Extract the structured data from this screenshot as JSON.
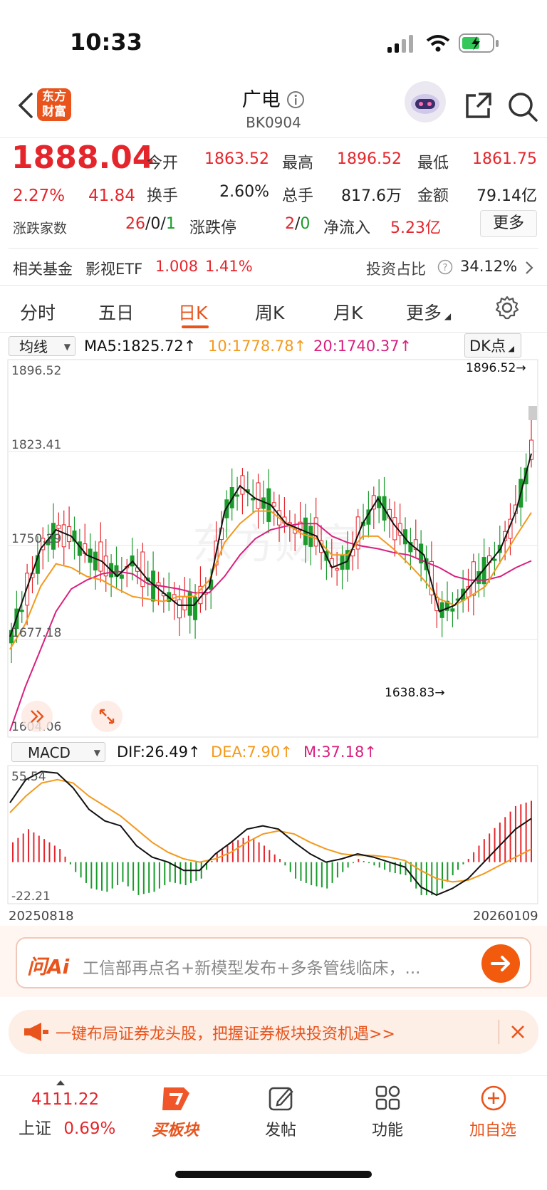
{
  "status": {
    "time": "10:33"
  },
  "header": {
    "logo_line1": "东方",
    "logo_line2": "财富",
    "title": "广电",
    "code": "BK0904"
  },
  "quote": {
    "price": "1888.04",
    "change_pct": "2.27%",
    "change": "41.84",
    "stats": {
      "open_label": "今开",
      "open": "1863.52",
      "high_label": "最高",
      "high": "1896.52",
      "low_label": "最低",
      "low": "1861.75",
      "turnover_label": "换手",
      "turnover": "2.60%",
      "volume_label": "总手",
      "volume": "817.6万",
      "amount_label": "金额",
      "amount": "79.14亿"
    },
    "breadth_label": "涨跌家数",
    "breadth_up": "26",
    "breadth_sep1": "/",
    "breadth_flat": "0",
    "breadth_sep2": "/",
    "breadth_down": "1",
    "limit_label": "涨跌停",
    "limit_up": "2",
    "limit_sep": "/",
    "limit_down": "0",
    "netflow_label": "净流入",
    "netflow": "5.23亿",
    "more_button": "更多"
  },
  "fund": {
    "label": "相关基金",
    "name": "影视ETF",
    "price": "1.008",
    "pct": "1.41%",
    "ratio_label": "投资占比",
    "ratio": "34.12%"
  },
  "tabs": [
    "分时",
    "五日",
    "日K",
    "周K",
    "月K",
    "更多"
  ],
  "chart": {
    "indicator_select": "均线",
    "ma5": "MA5:1825.72",
    "ma10": "10:1778.78",
    "ma20": "20:1740.37",
    "dk_button": "DK点",
    "y_labels": [
      "1896.52",
      "1823.41",
      "1750.29",
      "1677.18",
      "1604.06"
    ],
    "high_marker": "1896.52",
    "low_marker": "1638.83",
    "macd_select": "MACD",
    "dif": "DIF:26.49",
    "dea": "DEA:7.90",
    "m": "M:37.18",
    "macd_top": "55.54",
    "macd_bottom": "-22.21",
    "date_start": "20250818",
    "date_end": "20260109",
    "watermark": "东方财富"
  },
  "ai_bar": {
    "brand": "问Ai",
    "text": "工信部再点名+新模型发布+多条管线临床，..."
  },
  "promo": {
    "text": "一键布局证券龙头股，把握证券板块投资机遇>>"
  },
  "bottom_nav": {
    "index_value": "4111.22",
    "index_name": "上证",
    "index_pct": "0.69%",
    "buy_label": "买板块",
    "post_label": "发帖",
    "func_label": "功能",
    "add_label": "加自选"
  },
  "colors": {
    "up": "#e4262c",
    "down": "#1a9b2c",
    "accent": "#e8541c",
    "ma5": "#111111",
    "ma10": "#f39a1e",
    "ma20": "#d8207f"
  },
  "chart_data": [
    {
      "type": "candlestick",
      "title": "广电 日K",
      "y_range": [
        1604.06,
        1896.52
      ],
      "x_range": [
        "20250818",
        "20260109"
      ],
      "series": [
        {
          "name": "MA5",
          "values": [
            1680,
            1715,
            1750,
            1765,
            1760,
            1745,
            1740,
            1728,
            1740,
            1725,
            1715,
            1705,
            1705,
            1720,
            1780,
            1800,
            1790,
            1785,
            1770,
            1765,
            1760,
            1735,
            1740,
            1770,
            1790,
            1770,
            1755,
            1745,
            1700,
            1705,
            1720,
            1735,
            1750,
            1780,
            1825.72
          ]
        },
        {
          "name": "MA10",
          "values": [
            1670,
            1690,
            1720,
            1738,
            1735,
            1728,
            1725,
            1718,
            1712,
            1710,
            1708,
            1712,
            1712,
            1725,
            1755,
            1770,
            1780,
            1780,
            1770,
            1762,
            1758,
            1745,
            1745,
            1760,
            1760,
            1750,
            1738,
            1725,
            1710,
            1705,
            1712,
            1720,
            1740,
            1760,
            1778.78
          ]
        },
        {
          "name": "20",
          "values": [
            1605,
            1640,
            1670,
            1700,
            1718,
            1725,
            1730,
            1732,
            1730,
            1722,
            1720,
            1718,
            1715,
            1715,
            1728,
            1745,
            1758,
            1765,
            1768,
            1770,
            1770,
            1760,
            1755,
            1752,
            1750,
            1747,
            1745,
            1740,
            1735,
            1728,
            1725,
            1725,
            1728,
            1735,
            1740.37
          ]
        }
      ]
    },
    {
      "type": "line",
      "title": "MACD",
      "y_range": [
        -22.21,
        55.54
      ],
      "series": [
        {
          "name": "DIF",
          "values": [
            36,
            50,
            55,
            54,
            45,
            32,
            25,
            22,
            10,
            3,
            0,
            -5,
            -5,
            5,
            12,
            20,
            22,
            20,
            12,
            5,
            0,
            2,
            5,
            3,
            0,
            -3,
            -15,
            -20,
            -16,
            -10,
            0,
            10,
            20,
            26.49
          ]
        },
        {
          "name": "DEA",
          "values": [
            30,
            40,
            48,
            50,
            48,
            40,
            34,
            28,
            20,
            12,
            6,
            2,
            0,
            2,
            6,
            12,
            17,
            19,
            17,
            12,
            8,
            5,
            4,
            4,
            3,
            1,
            -5,
            -10,
            -12,
            -11,
            -7,
            -2,
            3,
            7.9
          ]
        },
        {
          "name": "M",
          "values": [
            12,
            20,
            14,
            8,
            -6,
            -16,
            -18,
            -12,
            -20,
            -18,
            -12,
            -14,
            -10,
            6,
            12,
            16,
            10,
            2,
            -10,
            -14,
            -16,
            -6,
            2,
            -2,
            -6,
            -8,
            -20,
            -20,
            -8,
            2,
            14,
            24,
            34,
            37.18
          ]
        }
      ]
    }
  ]
}
